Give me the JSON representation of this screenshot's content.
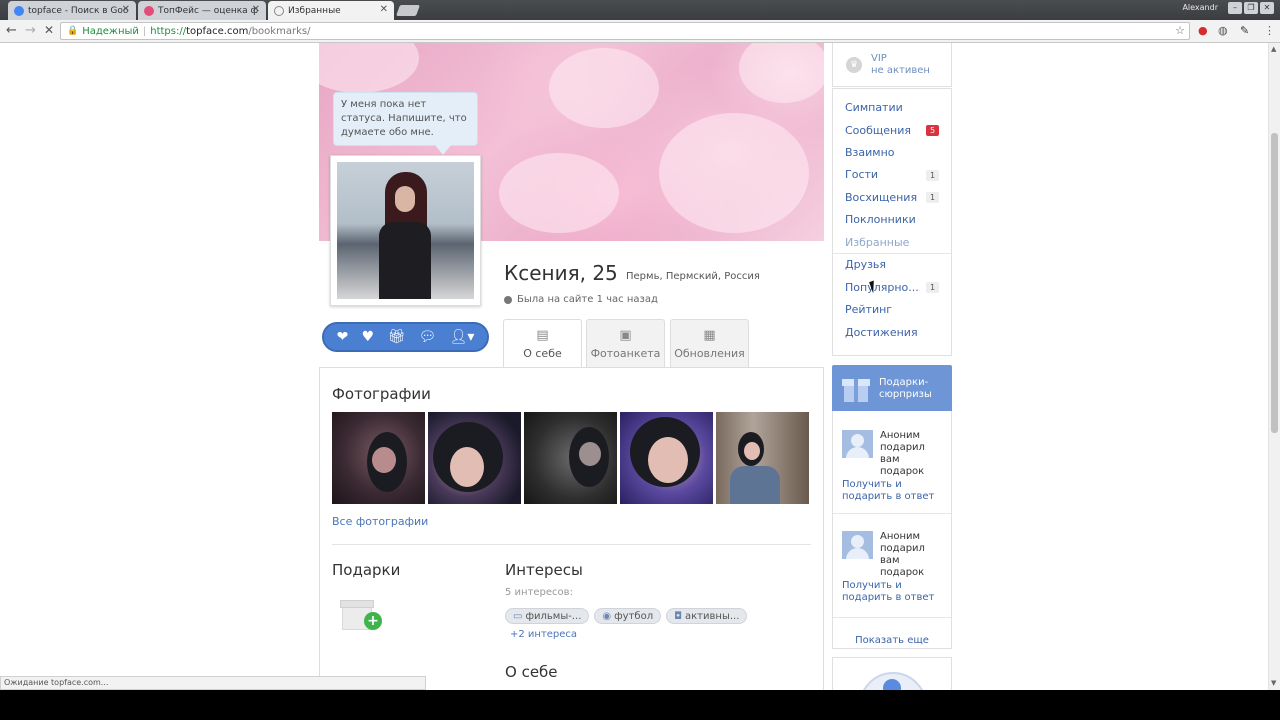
{
  "browser": {
    "tabs": [
      {
        "title": "topface - Поиск в Goo",
        "favicon_color": "#4285f4"
      },
      {
        "title": "ТопФейс — оценка ф",
        "favicon_color": "#e24d7a"
      },
      {
        "title": "Избранные",
        "favicon_color": "#888888"
      }
    ],
    "user": "Alexandr",
    "secure_label": "Надежный",
    "url_scheme": "https://",
    "url_host": "topface.com",
    "url_path": "/bookmarks/",
    "status_text": "Ожидание topface.com..."
  },
  "profile": {
    "status_bubble": "У меня пока нет статуса. Напишите, что думаете обо мне.",
    "name_age": "Ксения, 25",
    "location": "Пермь, Пермский, Россия",
    "last_seen": "Была на сайте 1 час назад",
    "tabs": [
      {
        "label": "О себе",
        "icon": "document-icon"
      },
      {
        "label": "Фотоанкета",
        "icon": "photo-icon"
      },
      {
        "label": "Обновления",
        "icon": "calendar-icon"
      }
    ],
    "actions": [
      "like-icon",
      "heart-icon",
      "gift-icon",
      "chat-icon",
      "user-menu-icon"
    ]
  },
  "content": {
    "photos_title": "Фотографии",
    "all_photos": "Все фотографии",
    "gifts_title": "Подарки",
    "interests_title": "Интересы",
    "interests_count": "5 интересов:",
    "interests": [
      {
        "label": "фильмы-...",
        "icon": "tv-icon"
      },
      {
        "label": "футбол",
        "icon": "gamepad-icon"
      },
      {
        "label": "активны...",
        "icon": "camera-icon"
      }
    ],
    "more_interests": "+2 интереса",
    "about_title": "О себе"
  },
  "sidebar": {
    "vip_line1": "VIP",
    "vip_line2": "не активен",
    "menu": [
      {
        "label": "Симпатии",
        "badge": ""
      },
      {
        "label": "Сообщения",
        "badge": "5"
      },
      {
        "label": "Взаимно",
        "badge": ""
      },
      {
        "label": "Гости",
        "badge": "1"
      },
      {
        "label": "Восхищения",
        "badge": "1"
      },
      {
        "label": "Поклонники",
        "badge": ""
      },
      {
        "label": "Избранные",
        "badge": ""
      },
      {
        "label": "Друзья",
        "badge": ""
      },
      {
        "label": "Популярно...",
        "badge": "1"
      },
      {
        "label": "Рейтинг",
        "badge": ""
      },
      {
        "label": "Достижения",
        "badge": ""
      }
    ],
    "gifts_header": "Подарки-сюрпризы",
    "gifts_header_line1": "Подарки-",
    "gifts_header_line2": "сюрпризы",
    "gift_entries": [
      {
        "text": "Аноним подарил вам подарок",
        "l1": "Аноним",
        "l2": "подарил",
        "l3": "вам",
        "l4": "подарок",
        "link1": "Получить и",
        "link2": "подарить в ответ"
      },
      {
        "text": "Аноним подарил вам подарок",
        "l1": "Аноним",
        "l2": "подарил",
        "l3": "вам",
        "l4": "подарок",
        "link1": "Получить и",
        "link2": "подарить в ответ"
      }
    ],
    "show_more": "Показать еще"
  }
}
